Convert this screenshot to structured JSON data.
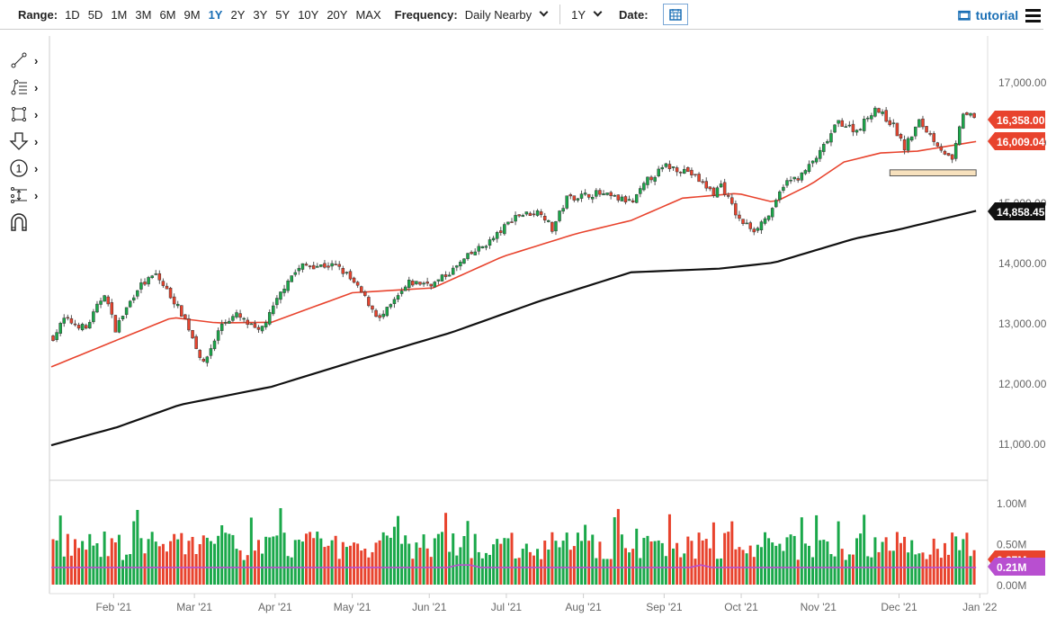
{
  "toolbar": {
    "range_label": "Range:",
    "ranges": [
      "1D",
      "5D",
      "1M",
      "3M",
      "6M",
      "9M",
      "1Y",
      "2Y",
      "3Y",
      "5Y",
      "10Y",
      "20Y",
      "MAX"
    ],
    "active_range": "1Y",
    "frequency_label": "Frequency:",
    "frequency_value": "Daily Nearby",
    "period_value": "1Y",
    "date_label": "Date:",
    "tutorial_label": "tutorial"
  },
  "left_tools": [
    "line-tool-icon",
    "fib-tool-icon",
    "rectangle-tool-icon",
    "arrow-down-tool-icon",
    "number-marker-tool-icon",
    "measure-tool-icon",
    "magnet-icon"
  ],
  "colors": {
    "up": "#1aa84a",
    "down": "#e8432d",
    "ma50": "#e8432d",
    "ma200": "#111111",
    "vol_ma": "#b84fd0",
    "highlight": "#f7e1bd"
  },
  "chart_data": {
    "type": "candlestick",
    "title": "",
    "x_tick_labels": [
      "Feb '21",
      "Mar '21",
      "Apr '21",
      "May '21",
      "Jun '21",
      "Jul '21",
      "Aug '21",
      "Sep '21",
      "Oct '21",
      "Nov '21",
      "Dec '21",
      "Jan '22"
    ],
    "x_tick_days": [
      17,
      39,
      61,
      82,
      103,
      124,
      145,
      167,
      188,
      209,
      231,
      253
    ],
    "y_tick_labels": [
      "11,000.00",
      "12,000.00",
      "13,000.00",
      "14,000.00",
      "15,000.00",
      "16,000.00",
      "17,000.00"
    ],
    "y_ticks": [
      11000,
      12000,
      13000,
      14000,
      15000,
      16000,
      17000
    ],
    "ylim": [
      10970,
      17600
    ],
    "trading_days": 252,
    "close_keypoints": [
      [
        0,
        12760
      ],
      [
        3,
        13060
      ],
      [
        9,
        12910
      ],
      [
        14,
        13500
      ],
      [
        17,
        12900
      ],
      [
        23,
        13580
      ],
      [
        28,
        13800
      ],
      [
        33,
        13360
      ],
      [
        36,
        13060
      ],
      [
        41,
        12310
      ],
      [
        46,
        12990
      ],
      [
        50,
        13130
      ],
      [
        56,
        12840
      ],
      [
        59,
        13130
      ],
      [
        64,
        13730
      ],
      [
        68,
        13950
      ],
      [
        77,
        13950
      ],
      [
        80,
        13800
      ],
      [
        84,
        13500
      ],
      [
        89,
        13060
      ],
      [
        94,
        13430
      ],
      [
        97,
        13660
      ],
      [
        104,
        13660
      ],
      [
        109,
        13880
      ],
      [
        113,
        14100
      ],
      [
        120,
        14400
      ],
      [
        126,
        14780
      ],
      [
        133,
        14850
      ],
      [
        136,
        14550
      ],
      [
        140,
        15070
      ],
      [
        148,
        15150
      ],
      [
        158,
        15000
      ],
      [
        162,
        15370
      ],
      [
        167,
        15600
      ],
      [
        173,
        15520
      ],
      [
        180,
        15150
      ],
      [
        182,
        15300
      ],
      [
        187,
        14700
      ],
      [
        191,
        14550
      ],
      [
        196,
        14850
      ],
      [
        199,
        15300
      ],
      [
        204,
        15450
      ],
      [
        209,
        15820
      ],
      [
        214,
        16340
      ],
      [
        219,
        16190
      ],
      [
        224,
        16570
      ],
      [
        229,
        16270
      ],
      [
        232,
        15900
      ],
      [
        236,
        16340
      ],
      [
        241,
        15970
      ],
      [
        245,
        15670
      ],
      [
        248,
        16490
      ],
      [
        252,
        16358
      ]
    ],
    "ma50_keypoints": [
      [
        0,
        12270
      ],
      [
        33,
        13090
      ],
      [
        45,
        13000
      ],
      [
        60,
        13010
      ],
      [
        82,
        13500
      ],
      [
        104,
        13580
      ],
      [
        123,
        14100
      ],
      [
        143,
        14480
      ],
      [
        158,
        14700
      ],
      [
        172,
        15070
      ],
      [
        187,
        15150
      ],
      [
        197,
        15000
      ],
      [
        207,
        15300
      ],
      [
        216,
        15670
      ],
      [
        226,
        15820
      ],
      [
        236,
        15850
      ],
      [
        252,
        16009.04
      ]
    ],
    "ma200_keypoints": [
      [
        0,
        10970
      ],
      [
        18,
        11270
      ],
      [
        35,
        11640
      ],
      [
        60,
        11940
      ],
      [
        84,
        12390
      ],
      [
        109,
        12840
      ],
      [
        133,
        13360
      ],
      [
        158,
        13840
      ],
      [
        182,
        13900
      ],
      [
        197,
        14000
      ],
      [
        219,
        14400
      ],
      [
        231,
        14550
      ],
      [
        252,
        14858.45
      ]
    ],
    "last_price_label": "16,358.00",
    "ma50_label": "16,009.04",
    "ma200_label": "14,858.45",
    "support_zone": {
      "from_day": 229,
      "to_day": 252,
      "low": 15440,
      "high": 15540
    },
    "volume": {
      "y_tick_labels": [
        "0.00M",
        "0.50M",
        "1.00M"
      ],
      "y_ticks": [
        0,
        0.5,
        1.0
      ],
      "ma_label": "0.21M",
      "ma_value": 0.21,
      "last_label": "0.27M"
    }
  }
}
